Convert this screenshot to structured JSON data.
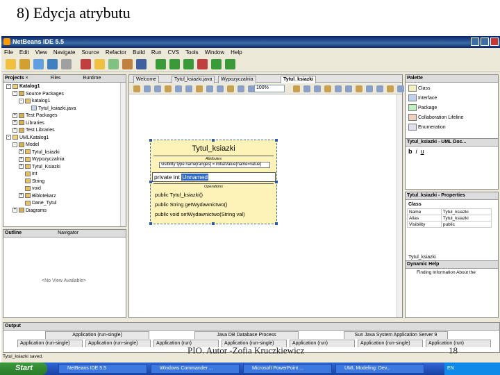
{
  "slide": {
    "title": "8) Edycja atrybutu",
    "footer": "PIO. Autor -Zofia Kruczkiewicz",
    "page": "18"
  },
  "window": {
    "title": "NetBeans IDE 5.5",
    "menu": [
      "File",
      "Edit",
      "View",
      "Navigate",
      "Source",
      "Refactor",
      "Build",
      "Run",
      "CVS",
      "Tools",
      "Window",
      "Help"
    ]
  },
  "projects": {
    "tabs": [
      "Projects",
      "Files",
      "Runtime"
    ],
    "items": [
      {
        "label": "Katalog1",
        "level": 0,
        "exp": "-",
        "bold": true
      },
      {
        "label": "Source Packages",
        "level": 1,
        "exp": "-"
      },
      {
        "label": "katalog1",
        "level": 2,
        "exp": "-"
      },
      {
        "label": "Tytul_ksiazki.java",
        "level": 3,
        "exp": ""
      },
      {
        "label": "Test Packages",
        "level": 1,
        "exp": "+"
      },
      {
        "label": "Libraries",
        "level": 1,
        "exp": "+"
      },
      {
        "label": "Test Libraries",
        "level": 1,
        "exp": "+"
      },
      {
        "label": "UMLKatalog1",
        "level": 0,
        "exp": "-"
      },
      {
        "label": "Model",
        "level": 1,
        "exp": "-"
      },
      {
        "label": "Tytul_ksiazki",
        "level": 2,
        "exp": "+"
      },
      {
        "label": "Wypozyczalnia",
        "level": 2,
        "exp": "+"
      },
      {
        "label": "Tytul_Ksiazki",
        "level": 2,
        "exp": "+"
      },
      {
        "label": "int",
        "level": 2,
        "exp": ""
      },
      {
        "label": "String",
        "level": 2,
        "exp": ""
      },
      {
        "label": "void",
        "level": 2,
        "exp": ""
      },
      {
        "label": "Biblotekarz",
        "level": 2,
        "exp": "+"
      },
      {
        "label": "Dane_Tytul",
        "level": 2,
        "exp": ""
      },
      {
        "label": "Diagrams",
        "level": 1,
        "exp": "+"
      }
    ]
  },
  "navigator": {
    "tabs": [
      "Outline",
      "Navigator"
    ],
    "empty": "<No View Available>"
  },
  "editor": {
    "tabs": [
      "Welcome",
      "Tytul_ksiazki.java",
      "Wypozyczalnia",
      "Tytul_ksiazki"
    ],
    "zoom": "100%"
  },
  "uml": {
    "class_name": "Tytul_ksiazki",
    "attributes_label": "Attributes",
    "hint": "visibility type name[ranges] = initialValue{name=value}",
    "edit_prefix": "private int",
    "edit_value": "Unnamed",
    "operations_label": "Operations",
    "operations": [
      "public Tytul_ksiazki()",
      "public String getWydawnictwo()",
      "public void setWydawnictwo(String val)"
    ]
  },
  "palette": {
    "title": "Palette",
    "items": [
      "Class",
      "Interface",
      "Package",
      "Collaboration Lifeline",
      "Enumeration"
    ]
  },
  "doc": {
    "title": "Tytul_ksiazki - UML Doc..."
  },
  "properties": {
    "title": "Tytul_ksiazki - Properties",
    "group": "Class",
    "rows": [
      [
        "Name",
        "Tytul_ksiazki"
      ],
      [
        "Alias",
        "Tytul_ksiazki"
      ],
      [
        "Visibility",
        "public"
      ]
    ],
    "footer": "Tytul_ksiazki"
  },
  "help": {
    "title": "Dynamic Help",
    "item": "Finding Information About the"
  },
  "output": {
    "title": "Output",
    "tabs": [
      "Application (run-single)",
      "Java DB Database Process",
      "Sun Java System Application Server 9"
    ],
    "tabs2": [
      "Application (run-single)",
      "Application (run-single)",
      "Application (run)",
      "Application (run-single)",
      "Application (run)",
      "Application (run-single)",
      "Application (run)"
    ]
  },
  "status": "Tytul_ksiazki saved.",
  "taskbar": {
    "start": "Start",
    "buttons": [
      "NetBeans IDE 5.5",
      "Windows Commander ...",
      "Microsoft PowerPoint ...",
      "UML Modeling: Dev..."
    ],
    "clock": "EN"
  },
  "colors": {
    "title_bar": "#0a246a",
    "uml_fill": "#fdf3b8",
    "selection": "#2a5aa8",
    "taskbar": "#3168d5"
  }
}
